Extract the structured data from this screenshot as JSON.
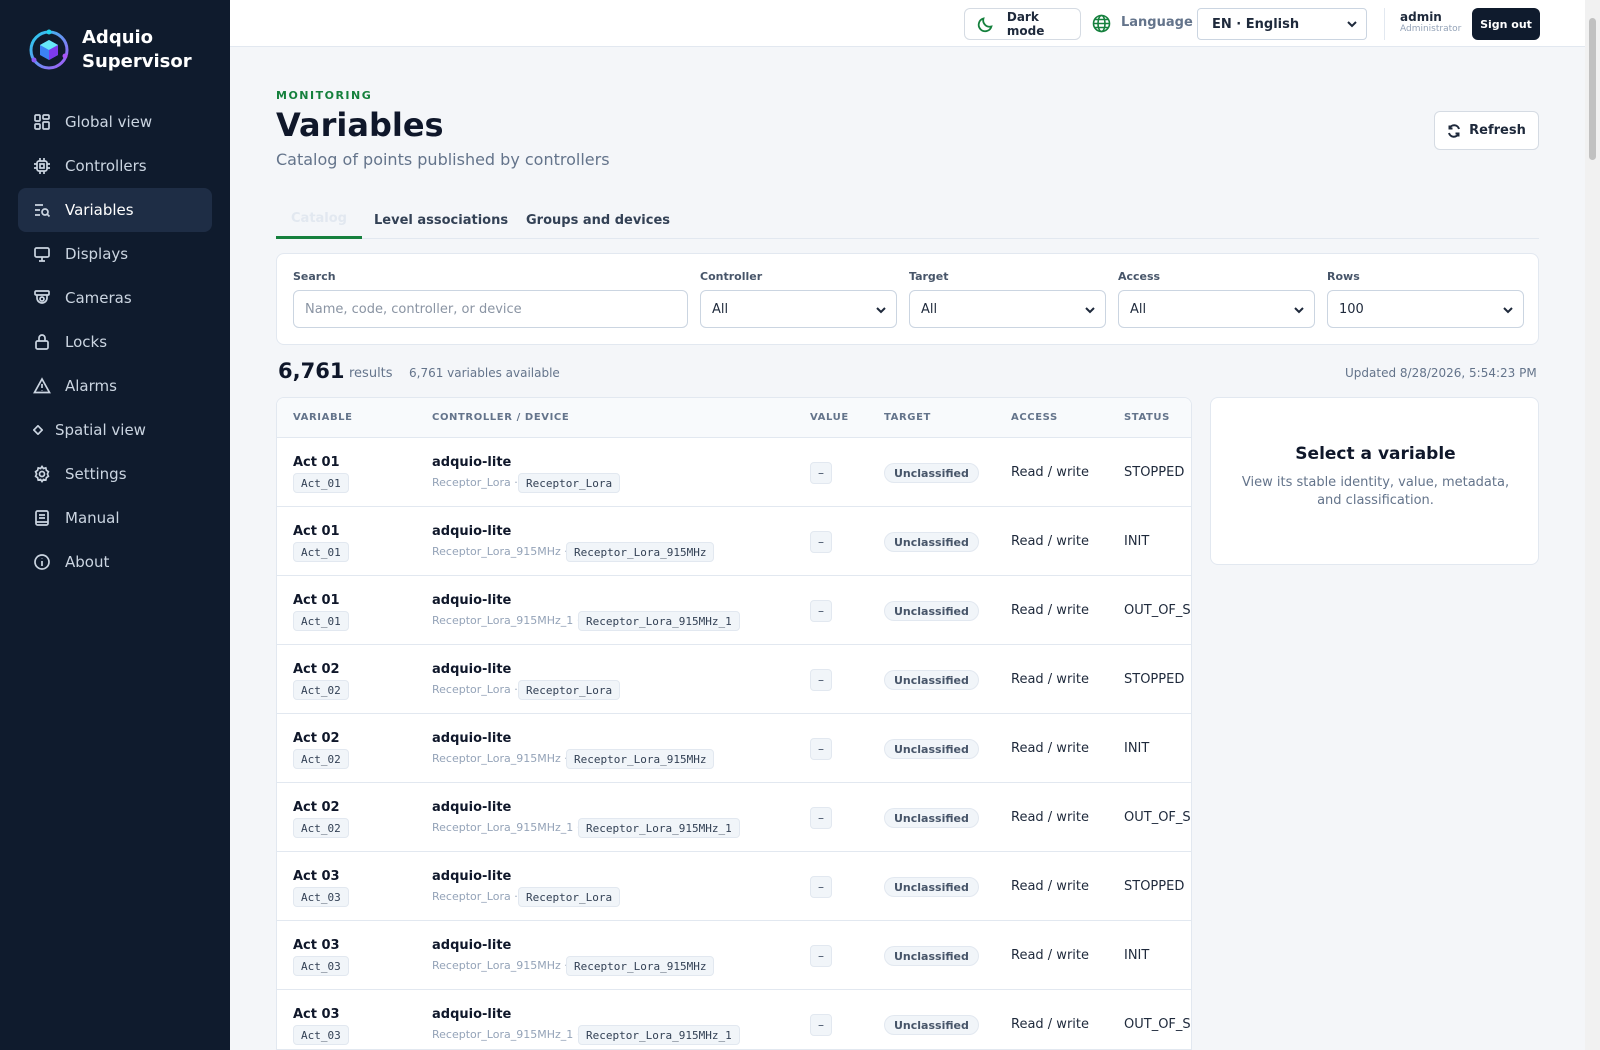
{
  "brand": {
    "line1": "Adquio",
    "line2": "Supervisor",
    "logo_icon": "adquio-cube-logo"
  },
  "nav": [
    {
      "label": "Global view",
      "icon": "grid-icon",
      "active": false
    },
    {
      "label": "Controllers",
      "icon": "chip-icon",
      "active": false
    },
    {
      "label": "Variables",
      "icon": "list-search-icon",
      "active": true
    },
    {
      "label": "Displays",
      "icon": "monitor-icon",
      "active": false
    },
    {
      "label": "Cameras",
      "icon": "camera-icon",
      "active": false
    },
    {
      "label": "Locks",
      "icon": "lock-icon",
      "active": false
    },
    {
      "label": "Alarms",
      "icon": "warning-icon",
      "active": false
    },
    {
      "label": "Spatial view",
      "icon": "diamond-icon",
      "active": false
    },
    {
      "label": "Settings",
      "icon": "gear-icon",
      "active": false
    },
    {
      "label": "Manual",
      "icon": "book-icon",
      "active": false
    },
    {
      "label": "About",
      "icon": "info-icon",
      "active": false
    }
  ],
  "topbar": {
    "dark_mode": "Dark mode",
    "language_label": "Language",
    "language_value": "EN · English",
    "user_name": "admin",
    "user_role": "Administrator",
    "sign_out": "Sign out"
  },
  "header": {
    "eyebrow": "MONITORING",
    "title": "Variables",
    "subtitle": "Catalog of points published by controllers",
    "refresh": "Refresh"
  },
  "tabs": [
    {
      "label": "Catalog",
      "active": true
    },
    {
      "label": "Level associations",
      "active": false
    },
    {
      "label": "Groups and devices",
      "active": false
    }
  ],
  "filters": {
    "search_label": "Search",
    "search_placeholder": "Name, code, controller, or device",
    "controller_label": "Controller",
    "controller_value": "All",
    "target_label": "Target",
    "target_value": "All",
    "access_label": "Access",
    "access_value": "All",
    "rows_label": "Rows",
    "rows_value": "100"
  },
  "results": {
    "count": "6,761",
    "count_label": "results",
    "available": "6,761 variables available",
    "updated": "Updated 8/28/2026, 5:54:23 PM"
  },
  "table": {
    "headers": [
      "VARIABLE",
      "CONTROLLER / DEVICE",
      "VALUE",
      "TARGET",
      "ACCESS",
      "STATUS"
    ],
    "rows": [
      {
        "name": "Act 01",
        "code": "Act_01",
        "controller": "adquio-lite",
        "device_sub": "Receptor_Lora ·",
        "device_chip": "Receptor_Lora",
        "value": "–",
        "target": "Unclassified",
        "access": "Read / write",
        "status": "STOPPED"
      },
      {
        "name": "Act 01",
        "code": "Act_01",
        "controller": "adquio-lite",
        "device_sub": "Receptor_Lora_915MHz ·",
        "device_chip": "Receptor_Lora_915MHz",
        "value": "–",
        "target": "Unclassified",
        "access": "Read / write",
        "status": "INIT"
      },
      {
        "name": "Act 01",
        "code": "Act_01",
        "controller": "adquio-lite",
        "device_sub": "Receptor_Lora_915MHz_1 ·",
        "device_chip": "Receptor_Lora_915MHz_1",
        "value": "–",
        "target": "Unclassified",
        "access": "Read / write",
        "status": "OUT_OF_SERVICE"
      },
      {
        "name": "Act 02",
        "code": "Act_02",
        "controller": "adquio-lite",
        "device_sub": "Receptor_Lora ·",
        "device_chip": "Receptor_Lora",
        "value": "–",
        "target": "Unclassified",
        "access": "Read / write",
        "status": "STOPPED"
      },
      {
        "name": "Act 02",
        "code": "Act_02",
        "controller": "adquio-lite",
        "device_sub": "Receptor_Lora_915MHz ·",
        "device_chip": "Receptor_Lora_915MHz",
        "value": "–",
        "target": "Unclassified",
        "access": "Read / write",
        "status": "INIT"
      },
      {
        "name": "Act 02",
        "code": "Act_02",
        "controller": "adquio-lite",
        "device_sub": "Receptor_Lora_915MHz_1 ·",
        "device_chip": "Receptor_Lora_915MHz_1",
        "value": "–",
        "target": "Unclassified",
        "access": "Read / write",
        "status": "OUT_OF_SERVICE"
      },
      {
        "name": "Act 03",
        "code": "Act_03",
        "controller": "adquio-lite",
        "device_sub": "Receptor_Lora ·",
        "device_chip": "Receptor_Lora",
        "value": "–",
        "target": "Unclassified",
        "access": "Read / write",
        "status": "STOPPED"
      },
      {
        "name": "Act 03",
        "code": "Act_03",
        "controller": "adquio-lite",
        "device_sub": "Receptor_Lora_915MHz ·",
        "device_chip": "Receptor_Lora_915MHz",
        "value": "–",
        "target": "Unclassified",
        "access": "Read / write",
        "status": "INIT"
      },
      {
        "name": "Act 03",
        "code": "Act_03",
        "controller": "adquio-lite",
        "device_sub": "Receptor_Lora_915MHz_1 ·",
        "device_chip": "Receptor_Lora_915MHz_1",
        "value": "–",
        "target": "Unclassified",
        "access": "Read / write",
        "status": "OUT_OF_SERVICE"
      }
    ]
  },
  "detail": {
    "title": "Select a variable",
    "text": "View its stable identity, value, metadata, and classification."
  },
  "colors": {
    "sidebar_bg": "#0f1b2d",
    "accent": "#15803d",
    "active_nav": "#1e2d45"
  }
}
